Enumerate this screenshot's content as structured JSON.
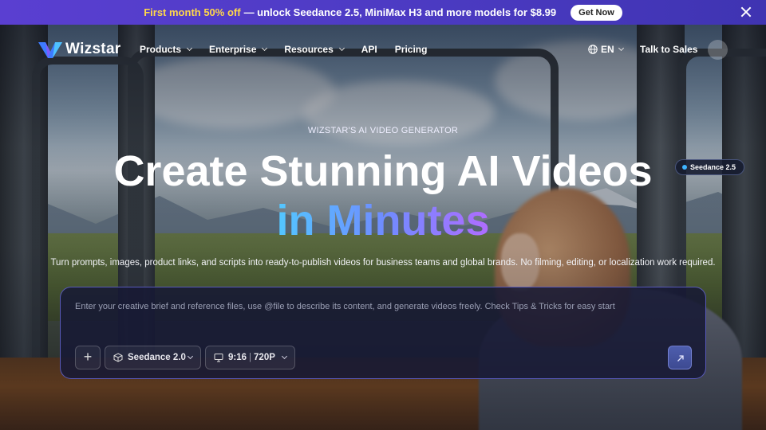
{
  "banner": {
    "highlight": "First month 50% off",
    "text": "— unlock Seedance 2.5, MiniMax H3 and more models for $8.99",
    "cta": "Get Now",
    "close_icon": "close-icon"
  },
  "nav": {
    "logo": "Wizstar",
    "items": [
      {
        "label": "Products",
        "dropdown": true
      },
      {
        "label": "Enterprise",
        "dropdown": true
      },
      {
        "label": "Resources",
        "dropdown": true
      },
      {
        "label": "API",
        "dropdown": false
      },
      {
        "label": "Pricing",
        "dropdown": false
      }
    ],
    "language": "EN",
    "sales": "Talk to Sales"
  },
  "hero": {
    "eyebrow": "WIZSTAR'S AI VIDEO GENERATOR",
    "title_line1": "Create Stunning AI Videos",
    "title_line2": "in Minutes",
    "model_badge": "Seedance 2.5",
    "subtitle": "Turn prompts, images, product links, and scripts into ready-to-publish videos for business teams and global brands. No filming, editing, or localization work required."
  },
  "prompt": {
    "placeholder": "Enter your creative brief and reference files, use @file to describe its content, and generate videos freely. Check Tips & Tricks for easy start",
    "add_label": "+",
    "model": "Seedance 2.0",
    "ratio": "9:16",
    "resolution": "720P"
  },
  "colors": {
    "banner_bg": "#4d3bc4",
    "banner_highlight": "#ffd84a",
    "accent_gradient": [
      "#53c7ff",
      "#6f8cff",
      "#b06cff"
    ],
    "prompt_border": "#6e6ee6"
  }
}
